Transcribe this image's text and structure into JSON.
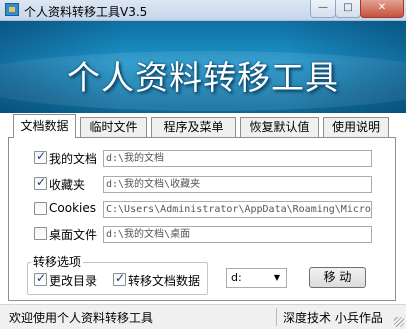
{
  "window": {
    "title": "个人资料转移工具V3.5",
    "minimize_glyph": "—",
    "maximize_glyph": "□",
    "close_glyph": "✕",
    "app_icon": "folder-app-icon"
  },
  "banner": {
    "title": "个人资料转移工具"
  },
  "tabs": [
    {
      "label": "文档数据",
      "active": true
    },
    {
      "label": "临时文件",
      "active": false
    },
    {
      "label": "程序及菜单",
      "active": false
    },
    {
      "label": "恢复默认值",
      "active": false
    },
    {
      "label": "使用说明",
      "active": false
    }
  ],
  "items": [
    {
      "label": "我的文档",
      "checked": true,
      "path": "d:\\我的文档"
    },
    {
      "label": "收藏夹",
      "checked": true,
      "path": "d:\\我的文档\\收藏夹"
    },
    {
      "label": "Cookies",
      "checked": false,
      "path": "C:\\Users\\Administrator\\AppData\\Roaming\\Micro"
    },
    {
      "label": "桌面文件",
      "checked": false,
      "path": "d:\\我的文档\\桌面"
    }
  ],
  "options": {
    "legend": "转移选项",
    "change_dir": {
      "label": "更改目录",
      "checked": true
    },
    "move_docs": {
      "label": "转移文档数据",
      "checked": true
    },
    "drive": "d:",
    "move_button": "移 动"
  },
  "status": {
    "left": "欢迎使用个人资料转移工具",
    "right": "深度技术 小兵作品"
  }
}
